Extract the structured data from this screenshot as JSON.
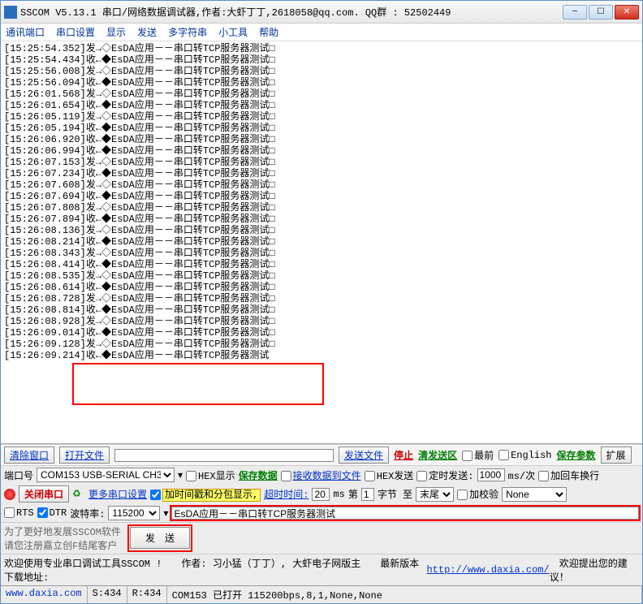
{
  "titlebar": {
    "title": "SSCOM V5.13.1 串口/网络数据调试器,作者:大虾丁丁,2618058@qq.com. QQ群 : 52502449"
  },
  "menu": {
    "items": [
      "通讯端口",
      "串口设置",
      "显示",
      "发送",
      "多字符串",
      "小工具",
      "帮助"
    ]
  },
  "log": {
    "lines": [
      "[15:25:54.352]发→◇EsDA应用－－串口转TCP服务器测试□",
      "[15:25:54.434]收←◆EsDA应用－－串口转TCP服务器测试□",
      "[15:25:56.008]发→◇EsDA应用－－串口转TCP服务器测试□",
      "[15:25:56.094]收←◆EsDA应用－－串口转TCP服务器测试□",
      "[15:26:01.568]发→◇EsDA应用－－串口转TCP服务器测试□",
      "[15:26:01.654]收←◆EsDA应用－－串口转TCP服务器测试□",
      "[15:26:05.119]发→◇EsDA应用－－串口转TCP服务器测试□",
      "[15:26:05.194]收←◆EsDA应用－－串口转TCP服务器测试□",
      "[15:26:06.920]收←◆EsDA应用－－串口转TCP服务器测试□",
      "[15:26:06.994]收←◆EsDA应用－－串口转TCP服务器测试□",
      "[15:26:07.153]发→◇EsDA应用－－串口转TCP服务器测试□",
      "[15:26:07.234]收←◆EsDA应用－－串口转TCP服务器测试□",
      "[15:26:07.608]发→◇EsDA应用－－串口转TCP服务器测试□",
      "[15:26:07.694]收←◆EsDA应用－－串口转TCP服务器测试□",
      "[15:26:07.808]发→◇EsDA应用－－串口转TCP服务器测试□",
      "[15:26:07.894]收←◆EsDA应用－－串口转TCP服务器测试□",
      "[15:26:08.136]发→◇EsDA应用－－串口转TCP服务器测试□",
      "[15:26:08.214]收←◆EsDA应用－－串口转TCP服务器测试□",
      "[15:26:08.343]发→◇EsDA应用－－串口转TCP服务器测试□",
      "[15:26:08.414]收←◆EsDA应用－－串口转TCP服务器测试□",
      "[15:26:08.535]发→◇EsDA应用－－串口转TCP服务器测试□",
      "[15:26:08.614]收←◆EsDA应用－－串口转TCP服务器测试□",
      "[15:26:08.728]发→◇EsDA应用－－串口转TCP服务器测试□",
      "[15:26:08.814]收←◆EsDA应用－－串口转TCP服务器测试□",
      "[15:26:08.928]发→◇EsDA应用－－串口转TCP服务器测试□",
      "[15:26:09.014]收←◆EsDA应用－－串口转TCP服务器测试□",
      "[15:26:09.128]发→◇EsDA应用－－串口转TCP服务器测试□",
      "[15:26:09.214]收←◆EsDA应用－－串口转TCP服务器测试"
    ]
  },
  "toolbar": {
    "clear": "清除窗口",
    "openfile": "打开文件",
    "sendfile": "发送文件",
    "stop": "停止",
    "clearsend": "清发送区",
    "front": "最前",
    "english": "English",
    "saveparam": "保存参数",
    "expand": "扩展"
  },
  "settings": {
    "portlabel": "端口号",
    "port": "COM153 USB-SERIAL CH340",
    "hexdisp": "HEX显示",
    "savedata": "保存数据",
    "recvtofile": "接收数据到文件",
    "hexsend": "HEX发送",
    "timedsend": "定时发送:",
    "interval": "1000",
    "intervalunit": "ms/次",
    "addcrlf": "加回车换行",
    "closeport": "关闭串口",
    "moreport": "更多串口设置",
    "timestamp": "加时间戳和分包显示,",
    "timeout_lbl": "超时时间:",
    "timeout": "20",
    "ms": "ms",
    "nth": "第",
    "bytenum": "1",
    "byteunit": "字节 至",
    "endpos": "末尾",
    "addcheck": "加校验",
    "checktype": "None",
    "rts": "RTS",
    "dtr": "DTR",
    "baudlabel": "波特率:",
    "baud": "115200",
    "sendtext": "EsDA应用－－串口转TCP服务器测试",
    "sendbtn": "发　送"
  },
  "footer": {
    "note1": "为了更好地发展SSCOM软件",
    "note2": "请您注册嘉立创F结尾客户",
    "welcome": "欢迎使用专业串口调试工具SSCOM !　　作者: 习小猛（丁丁）, 大虾电子网版主　　最新版本下载地址:",
    "url": "http://www.daxia.com/",
    "welcome2": "　欢迎提出您的建议！"
  },
  "status": {
    "site": "www.daxia.com",
    "s": "S:434",
    "r": "R:434",
    "info": "COM153 已打开 115200bps,8,1,None,None"
  }
}
